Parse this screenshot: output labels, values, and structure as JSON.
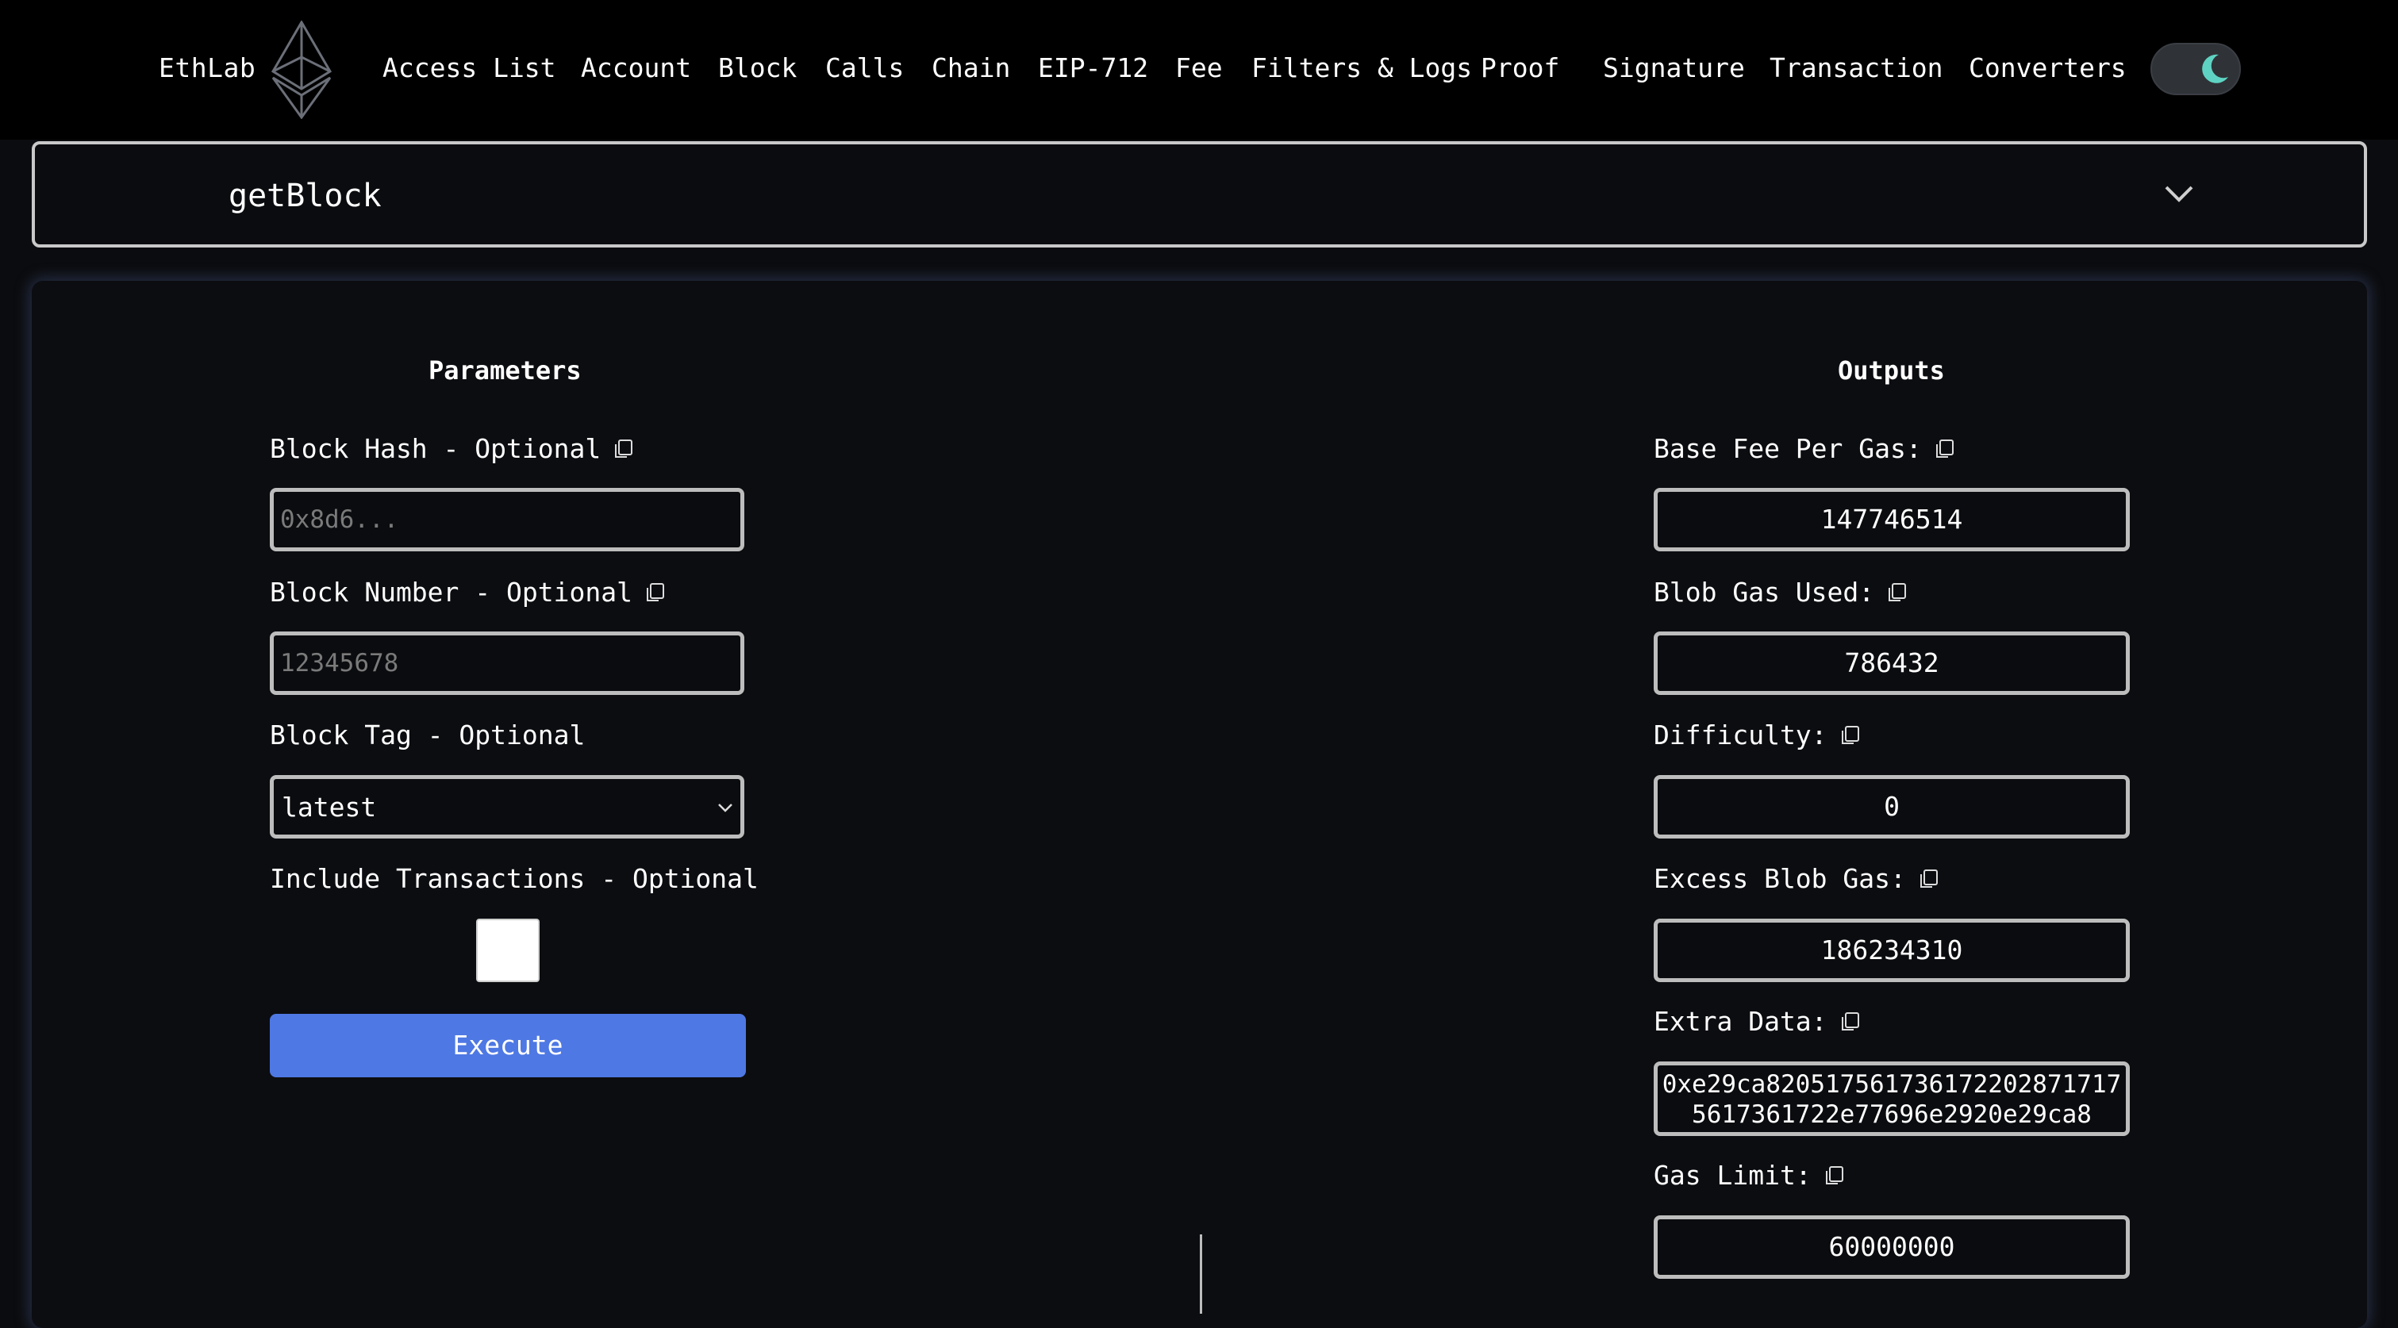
{
  "header": {
    "brand": "EthLab",
    "nav": [
      "Access List",
      "Account",
      "Block",
      "Calls",
      "Chain",
      "EIP-712",
      "Fee",
      "Filters & Logs",
      "Proof",
      "Signature",
      "Transaction",
      "Converters"
    ],
    "theme_toggle_icon": "moon-icon",
    "accent_color": "#5fd3c3"
  },
  "method": {
    "name": "getBlock"
  },
  "parameters": {
    "title": "Parameters",
    "block_hash_label": "Block Hash - Optional",
    "block_hash_placeholder": "0x8d6...",
    "block_number_label": "Block Number - Optional",
    "block_number_placeholder": "12345678",
    "block_tag_label": "Block Tag - Optional",
    "block_tag_value": "latest",
    "include_tx_label": "Include Transactions - Optional",
    "include_tx_checked": false,
    "execute_label": "Execute",
    "execute_color": "#4e78e3"
  },
  "outputs": {
    "title": "Outputs",
    "items": [
      {
        "label": "Base Fee Per Gas:",
        "value": "147746514"
      },
      {
        "label": "Blob Gas Used:",
        "value": "786432"
      },
      {
        "label": "Difficulty:",
        "value": "0"
      },
      {
        "label": "Excess Blob Gas:",
        "value": "186234310"
      },
      {
        "label": "Extra Data:",
        "value": "0xe29ca8205175617361722028717175617361722e77696e2920e29ca8"
      },
      {
        "label": "Gas Limit:",
        "value": "60000000"
      }
    ]
  }
}
